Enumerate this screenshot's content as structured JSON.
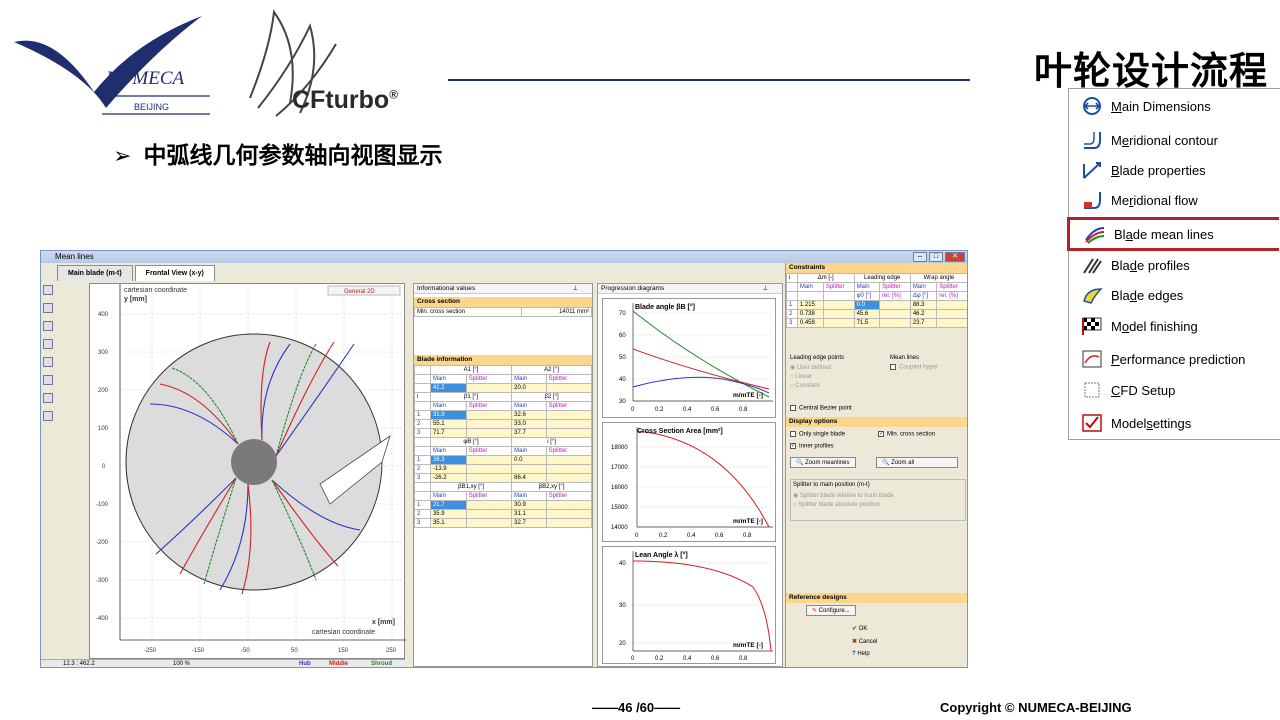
{
  "slide": {
    "title": "叶轮设计流程",
    "bullet_arrow": "➢",
    "bullet": "中弧线几何参数轴向视图显示",
    "logo_numeca": "NUMECA",
    "logo_beijing": "BEIJING",
    "logo_cfturbo": "CFturbo",
    "registered": "®",
    "page": "——46 /60——",
    "copyright": "Copyright © NUMECA-BEIJING"
  },
  "menu": {
    "items": [
      {
        "pre": "",
        "u": "M",
        "post": "ain Dimensions",
        "icon": "main-dimensions-icon"
      },
      {
        "pre": "M",
        "u": "e",
        "post": "ridional contour",
        "icon": "meridional-contour-icon"
      },
      {
        "pre": "",
        "u": "B",
        "post": "lade properties",
        "icon": "blade-properties-icon"
      },
      {
        "pre": "Me",
        "u": "r",
        "post": "idional flow",
        "icon": "meridional-flow-icon"
      },
      {
        "pre": "Bl",
        "u": "a",
        "post": "de mean lines",
        "icon": "blade-mean-lines-icon",
        "active": true
      },
      {
        "pre": "Bla",
        "u": "d",
        "post": "e profiles",
        "icon": "blade-profiles-icon"
      },
      {
        "pre": "Bla",
        "u": "d",
        "post": "e edges",
        "icon": "blade-edges-icon"
      },
      {
        "pre": "M",
        "u": "o",
        "post": "del finishing",
        "icon": "model-finishing-icon"
      },
      {
        "pre": "",
        "u": "P",
        "post": "erformance prediction",
        "icon": "performance-prediction-icon"
      },
      {
        "pre": "",
        "u": "C",
        "post": "FD Setup",
        "icon": "cfd-setup-icon"
      },
      {
        "pre": "Model ",
        "u": "s",
        "post": "ettings",
        "icon": "model-settings-icon"
      }
    ]
  },
  "window": {
    "title": "Mean lines",
    "tabs": [
      "Main blade (m-t)",
      "Frontal View (x-y)"
    ],
    "plot": {
      "coord_label": "cartesian coordinate",
      "y_label": "y [mm]",
      "x_label": "x [mm]",
      "badge": "General 2D",
      "y_ticks": [
        "400",
        "300",
        "200",
        "100",
        "0",
        "-100",
        "-200",
        "-300",
        "-400"
      ],
      "x_ticks": [
        "-250",
        "-150",
        "-50",
        "50",
        "150",
        "250"
      ]
    },
    "status": {
      "coords": "12.3 : 462.2",
      "zoom": "100 %",
      "hub": "Hub",
      "middle": "Middle",
      "shroud": "Shroud"
    },
    "info": {
      "header": "Informational values",
      "pin": "⊥",
      "cross_section": "Cross section",
      "min_cross_label": "Min. cross section",
      "min_cross_value": "14011 mm²",
      "blade_info": "Blade information",
      "main": "Main",
      "splitter": "Splitter",
      "a1": "A1 [°]",
      "a2": "A2 [°]",
      "a_row": [
        "41.2",
        "",
        "20.0",
        ""
      ],
      "b1": "β1 [°]",
      "b2": "β2 [°]",
      "beta_rows": [
        [
          "1",
          "31.9",
          "",
          "32.6",
          ""
        ],
        [
          "2",
          "55.1",
          "",
          "33.0",
          ""
        ],
        [
          "3",
          "71.7",
          "",
          "37.7",
          ""
        ]
      ],
      "phi": "φB [°]",
      "i": "i [°]",
      "phi_rows": [
        [
          "1",
          "26.3",
          "",
          "0.0",
          ""
        ],
        [
          "2",
          "-13.9",
          "",
          "",
          ""
        ],
        [
          "3",
          "-26.2",
          "",
          "86.4",
          ""
        ]
      ],
      "bb1": "βB1,xy [°]",
      "bb2": "βB2,xy [°]",
      "bb_rows": [
        [
          "1",
          "21.7",
          "",
          "30.9",
          ""
        ],
        [
          "2",
          "35.9",
          "",
          "31.1",
          ""
        ],
        [
          "3",
          "35.1",
          "",
          "32.7",
          ""
        ]
      ]
    },
    "prog": {
      "header": "Progression diagrams",
      "pin": "⊥",
      "c1_title": "Blade angle βB [°]",
      "c1_y": [
        "70",
        "60",
        "50",
        "40",
        "30"
      ],
      "c2_title": "Cross Section Area [mm²]",
      "c2_y": [
        "18000",
        "17000",
        "16000",
        "15000",
        "14000"
      ],
      "c3_title": "Lean Angle λ [°]",
      "c3_y": [
        "40",
        "30",
        "20"
      ],
      "x_ticks": [
        "0",
        "0.2",
        "0.4",
        "0.6",
        "0.8"
      ],
      "x_label": "m/mTE [-]"
    },
    "cons": {
      "header": "Constraints",
      "dm": "Δm [-]",
      "le": "Leading edge",
      "wrap": "Wrap angle",
      "main": "Main",
      "splitter": "Splitter",
      "phi0": "φ0 [°]",
      "rel": "rel. [%]",
      "dphi": "Δφ [°]",
      "idx": "i",
      "rows": [
        [
          "1",
          "1.215",
          "",
          "0.0",
          "",
          "88.3",
          ""
        ],
        [
          "2",
          "0.738",
          "",
          "45.6",
          "",
          "46.2",
          ""
        ],
        [
          "3",
          "0.458",
          "",
          "71.5",
          "",
          "23.7",
          ""
        ]
      ],
      "le_points": "Leading edge points",
      "user_defined": "User defined",
      "linear": "Linear",
      "constant": "Constant",
      "mean_lines": "Mean lines",
      "coupled": "Coupled hyper",
      "central_bezier": "Central Bezier point",
      "display_options": "Display options",
      "only_single": "Only single blade",
      "min_cross": "Min. cross section",
      "inner_profiles": "Inner profiles",
      "zoom_meanlines": "Zoom meanlines",
      "zoom_all": "Zoom all",
      "splitter_main": "Splitter to main position (m-t)",
      "split_rel": "Splitter blade relative to main blade",
      "split_abs": "Splitter blade absolute position",
      "reference": "Reference designs",
      "configure": "Configure...",
      "ok": "OK",
      "cancel": "Cancel",
      "help": "Help"
    }
  },
  "colors": {
    "accent_red": "#b0232a",
    "navy": "#1f2e6f",
    "hub": "#2636c8",
    "middle": "#d42020",
    "shroud": "#1f8a2a",
    "section_header": "#fbd68c"
  }
}
